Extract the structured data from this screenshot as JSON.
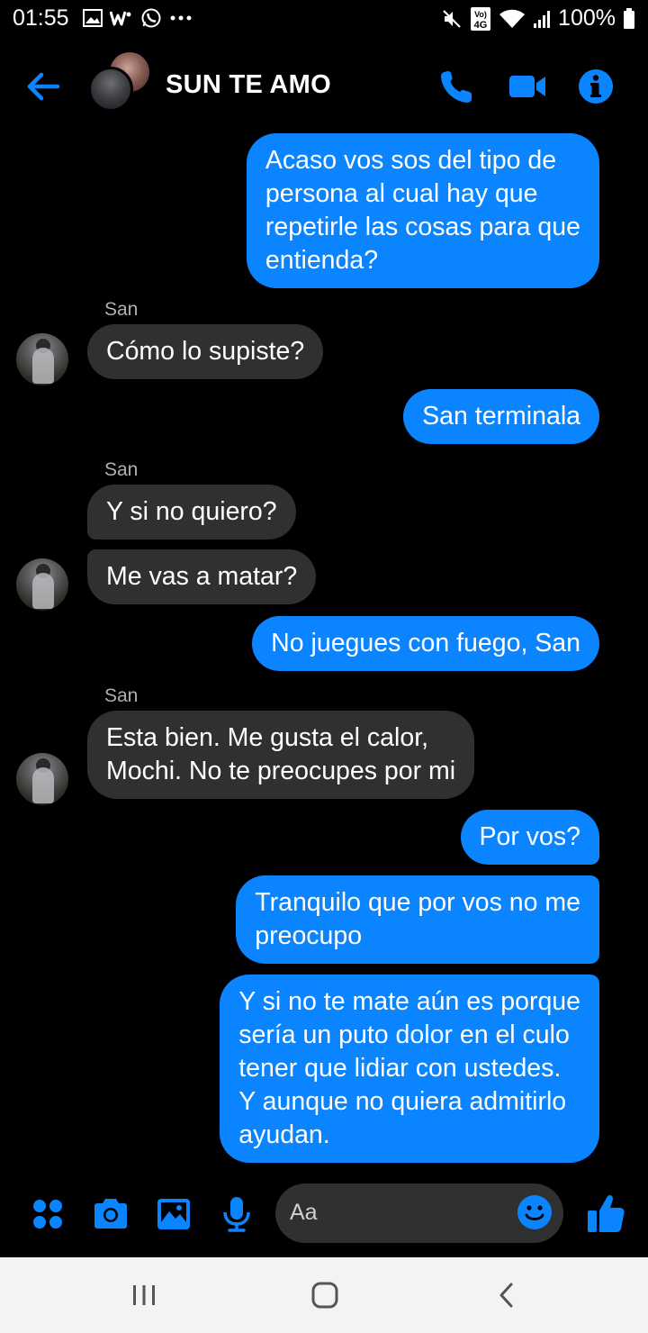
{
  "status_bar": {
    "time": "01:55",
    "battery": "100%",
    "left_icons": [
      "gallery-icon",
      "w-app-icon",
      "whatsapp-icon",
      "more-dots-icon"
    ],
    "right_icons": [
      "mute-icon",
      "volte-4g-icon",
      "wifi-icon",
      "signal-icon",
      "battery-icon"
    ],
    "network_badge_top": "Vo)",
    "network_badge_bottom": "4G"
  },
  "header": {
    "title": "SUN TE AMO",
    "icons": [
      "back-arrow-icon",
      "phone-icon",
      "video-camera-icon",
      "info-icon"
    ],
    "accent_color": "#0a84ff"
  },
  "messages": [
    {
      "from": "me",
      "text": "Acaso vos sos del tipo de\npersona al cual hay que\nrepetirle las cosas para que\nentienda?"
    },
    {
      "from": "San",
      "sender_label": "San",
      "text": "Cómo lo supiste?"
    },
    {
      "from": "me",
      "text": "San terminala"
    },
    {
      "from": "San",
      "sender_label": "San",
      "text": "Y si no quiero?"
    },
    {
      "from": "San",
      "text": "Me vas a matar?"
    },
    {
      "from": "me",
      "text": "No juegues con fuego, San"
    },
    {
      "from": "San",
      "sender_label": "San",
      "text": "Esta bien. Me gusta el calor,\nMochi. No te preocupes por mi"
    },
    {
      "from": "me",
      "text": "Por vos?"
    },
    {
      "from": "me",
      "text": "Tranquilo que por vos no me\npreocupo"
    },
    {
      "from": "me",
      "text": "Y si no te mate aún es porque\nsería un puto dolor en el culo\ntener que lidiar con ustedes.\nY aunque no quiera admitirlo\nayudan."
    }
  ],
  "composer": {
    "placeholder": "Aa",
    "icons": [
      "apps-grid-icon",
      "camera-icon",
      "image-icon",
      "microphone-icon",
      "emoji-icon",
      "thumbs-up-icon"
    ]
  },
  "colors": {
    "sent_bubble": "#0a84ff",
    "received_bubble": "#303030",
    "background": "#000000"
  }
}
